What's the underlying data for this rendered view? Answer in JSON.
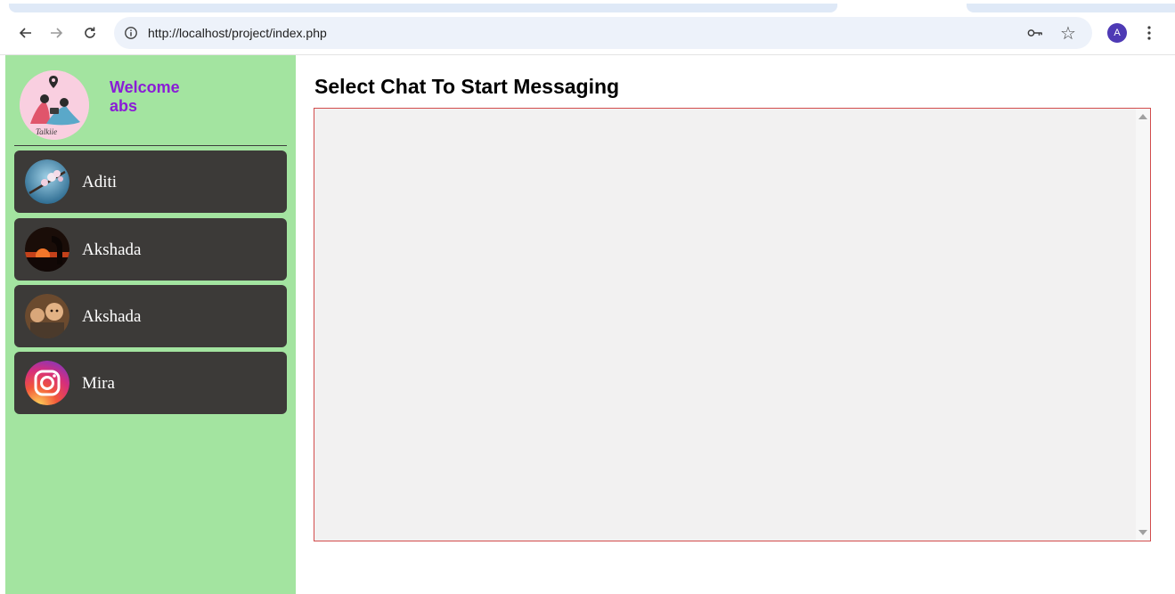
{
  "browser": {
    "url": "http://localhost/project/index.php",
    "profile_initial": "A"
  },
  "sidebar": {
    "welcome_line1": "Welcome",
    "welcome_line2": "abs",
    "logo_text": "Talkiie",
    "contacts": [
      {
        "name": "Aditi",
        "avatar": "cherry-blossom-photo"
      },
      {
        "name": "Akshada",
        "avatar": "sunset-silhouette-photo"
      },
      {
        "name": "Akshada",
        "avatar": "children-photo"
      },
      {
        "name": "Mira",
        "avatar": "instagram-logo"
      }
    ]
  },
  "main": {
    "title": "Select Chat To Start Messaging"
  },
  "colors": {
    "sidebar_bg": "#a3e4a0",
    "contact_bg": "#3c3a38",
    "welcome_text": "#8a1cd6",
    "chat_border": "#d24c4c",
    "chat_bg": "#f2f1f1"
  }
}
